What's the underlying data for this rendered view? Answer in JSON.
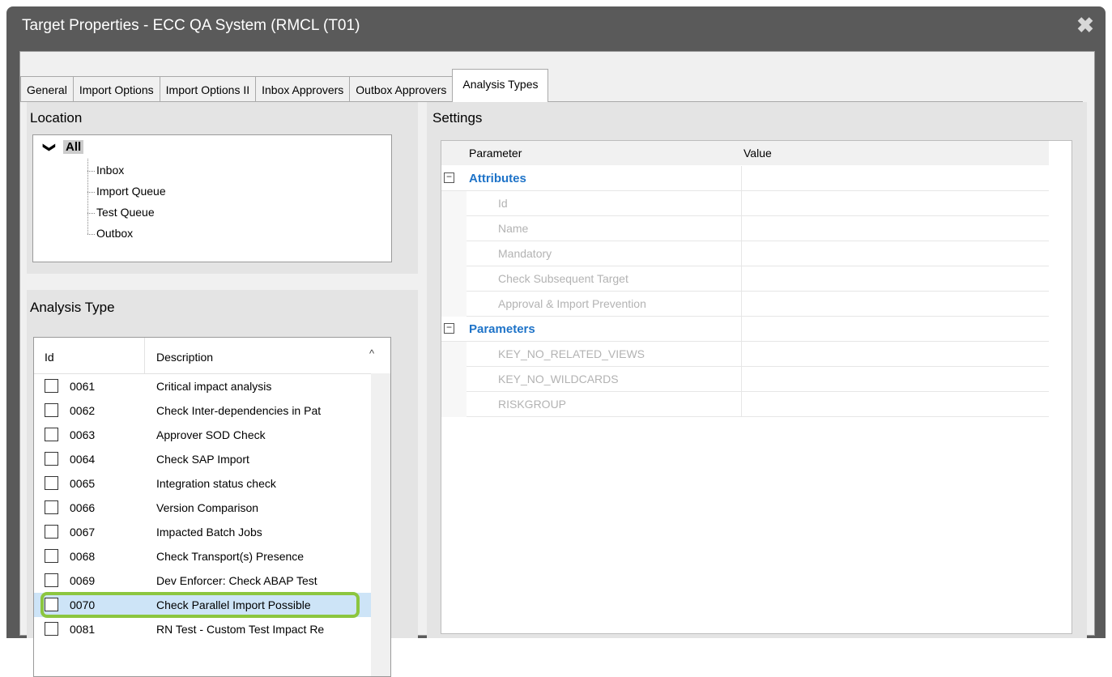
{
  "window": {
    "title": "Target Properties - ECC QA System (RMCL (T01)",
    "close_glyph": "✖"
  },
  "tabs": [
    {
      "label": "General"
    },
    {
      "label": "Import Options"
    },
    {
      "label": "Import Options II"
    },
    {
      "label": "Inbox Approvers"
    },
    {
      "label": "Outbox Approvers"
    },
    {
      "label": "Analysis Types",
      "active": true
    }
  ],
  "location": {
    "title": "Location",
    "root": {
      "chevron": "❯",
      "label": "All"
    },
    "items": [
      {
        "label": "Inbox"
      },
      {
        "label": "Import Queue"
      },
      {
        "label": "Test Queue"
      },
      {
        "label": "Outbox"
      }
    ]
  },
  "analysis_type": {
    "title": "Analysis Type",
    "col_id": "Id",
    "col_desc": "Description",
    "sort_arrow": "^",
    "rows": [
      {
        "id": "0061",
        "desc": "Critical impact analysis"
      },
      {
        "id": "0062",
        "desc": "Check Inter-dependencies in Pat"
      },
      {
        "id": "0063",
        "desc": "Approver SOD Check"
      },
      {
        "id": "0064",
        "desc": "Check SAP Import"
      },
      {
        "id": "0065",
        "desc": "Integration status check"
      },
      {
        "id": "0066",
        "desc": "Version Comparison"
      },
      {
        "id": "0067",
        "desc": "Impacted Batch Jobs"
      },
      {
        "id": "0068",
        "desc": "Check Transport(s) Presence"
      },
      {
        "id": "0069",
        "desc": "Dev Enforcer: Check ABAP Test"
      },
      {
        "id": "0070",
        "desc": "Check Parallel Import Possible"
      },
      {
        "id": "0081",
        "desc": "RN Test - Custom Test Impact Re"
      }
    ]
  },
  "settings": {
    "title": "Settings",
    "col_param": "Parameter",
    "col_value": "Value",
    "expand_glyph": "−",
    "groups": [
      {
        "name": "Attributes",
        "params": [
          "Id",
          "Name",
          "Mandatory",
          "Check Subsequent Target",
          "Approval & Import Prevention"
        ]
      },
      {
        "name": "Parameters",
        "params": [
          "KEY_NO_RELATED_VIEWS",
          "KEY_NO_WILDCARDS",
          "RISKGROUP"
        ]
      }
    ]
  },
  "colors": {
    "highlight": "#8cc63f",
    "category_text": "#1e73c8",
    "title_bar": "#5a5a5a"
  }
}
